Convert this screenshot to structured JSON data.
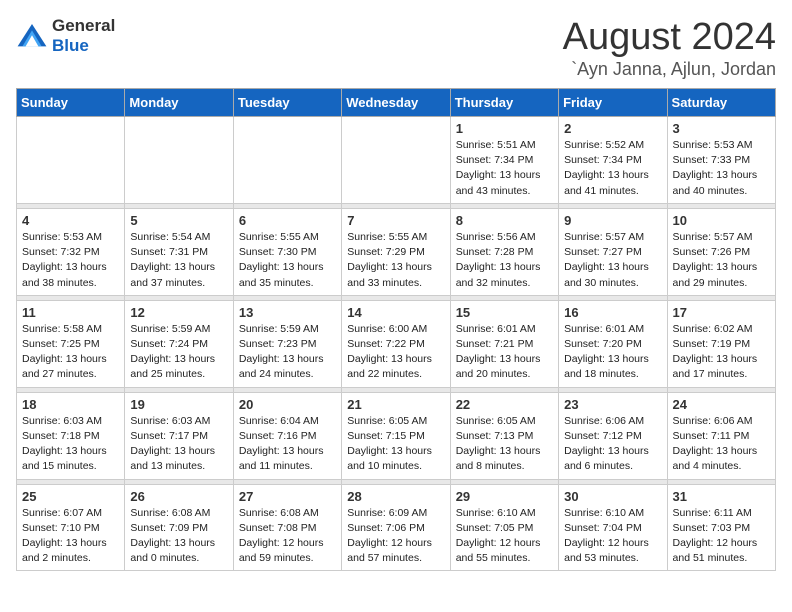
{
  "header": {
    "logo": {
      "general": "General",
      "blue": "Blue"
    },
    "title": "August 2024",
    "location": "`Ayn Janna, Ajlun, Jordan"
  },
  "days_of_week": [
    "Sunday",
    "Monday",
    "Tuesday",
    "Wednesday",
    "Thursday",
    "Friday",
    "Saturday"
  ],
  "weeks": [
    [
      {
        "day": "",
        "info": ""
      },
      {
        "day": "",
        "info": ""
      },
      {
        "day": "",
        "info": ""
      },
      {
        "day": "",
        "info": ""
      },
      {
        "day": "1",
        "info": "Sunrise: 5:51 AM\nSunset: 7:34 PM\nDaylight: 13 hours\nand 43 minutes."
      },
      {
        "day": "2",
        "info": "Sunrise: 5:52 AM\nSunset: 7:34 PM\nDaylight: 13 hours\nand 41 minutes."
      },
      {
        "day": "3",
        "info": "Sunrise: 5:53 AM\nSunset: 7:33 PM\nDaylight: 13 hours\nand 40 minutes."
      }
    ],
    [
      {
        "day": "4",
        "info": "Sunrise: 5:53 AM\nSunset: 7:32 PM\nDaylight: 13 hours\nand 38 minutes."
      },
      {
        "day": "5",
        "info": "Sunrise: 5:54 AM\nSunset: 7:31 PM\nDaylight: 13 hours\nand 37 minutes."
      },
      {
        "day": "6",
        "info": "Sunrise: 5:55 AM\nSunset: 7:30 PM\nDaylight: 13 hours\nand 35 minutes."
      },
      {
        "day": "7",
        "info": "Sunrise: 5:55 AM\nSunset: 7:29 PM\nDaylight: 13 hours\nand 33 minutes."
      },
      {
        "day": "8",
        "info": "Sunrise: 5:56 AM\nSunset: 7:28 PM\nDaylight: 13 hours\nand 32 minutes."
      },
      {
        "day": "9",
        "info": "Sunrise: 5:57 AM\nSunset: 7:27 PM\nDaylight: 13 hours\nand 30 minutes."
      },
      {
        "day": "10",
        "info": "Sunrise: 5:57 AM\nSunset: 7:26 PM\nDaylight: 13 hours\nand 29 minutes."
      }
    ],
    [
      {
        "day": "11",
        "info": "Sunrise: 5:58 AM\nSunset: 7:25 PM\nDaylight: 13 hours\nand 27 minutes."
      },
      {
        "day": "12",
        "info": "Sunrise: 5:59 AM\nSunset: 7:24 PM\nDaylight: 13 hours\nand 25 minutes."
      },
      {
        "day": "13",
        "info": "Sunrise: 5:59 AM\nSunset: 7:23 PM\nDaylight: 13 hours\nand 24 minutes."
      },
      {
        "day": "14",
        "info": "Sunrise: 6:00 AM\nSunset: 7:22 PM\nDaylight: 13 hours\nand 22 minutes."
      },
      {
        "day": "15",
        "info": "Sunrise: 6:01 AM\nSunset: 7:21 PM\nDaylight: 13 hours\nand 20 minutes."
      },
      {
        "day": "16",
        "info": "Sunrise: 6:01 AM\nSunset: 7:20 PM\nDaylight: 13 hours\nand 18 minutes."
      },
      {
        "day": "17",
        "info": "Sunrise: 6:02 AM\nSunset: 7:19 PM\nDaylight: 13 hours\nand 17 minutes."
      }
    ],
    [
      {
        "day": "18",
        "info": "Sunrise: 6:03 AM\nSunset: 7:18 PM\nDaylight: 13 hours\nand 15 minutes."
      },
      {
        "day": "19",
        "info": "Sunrise: 6:03 AM\nSunset: 7:17 PM\nDaylight: 13 hours\nand 13 minutes."
      },
      {
        "day": "20",
        "info": "Sunrise: 6:04 AM\nSunset: 7:16 PM\nDaylight: 13 hours\nand 11 minutes."
      },
      {
        "day": "21",
        "info": "Sunrise: 6:05 AM\nSunset: 7:15 PM\nDaylight: 13 hours\nand 10 minutes."
      },
      {
        "day": "22",
        "info": "Sunrise: 6:05 AM\nSunset: 7:13 PM\nDaylight: 13 hours\nand 8 minutes."
      },
      {
        "day": "23",
        "info": "Sunrise: 6:06 AM\nSunset: 7:12 PM\nDaylight: 13 hours\nand 6 minutes."
      },
      {
        "day": "24",
        "info": "Sunrise: 6:06 AM\nSunset: 7:11 PM\nDaylight: 13 hours\nand 4 minutes."
      }
    ],
    [
      {
        "day": "25",
        "info": "Sunrise: 6:07 AM\nSunset: 7:10 PM\nDaylight: 13 hours\nand 2 minutes."
      },
      {
        "day": "26",
        "info": "Sunrise: 6:08 AM\nSunset: 7:09 PM\nDaylight: 13 hours\nand 0 minutes."
      },
      {
        "day": "27",
        "info": "Sunrise: 6:08 AM\nSunset: 7:08 PM\nDaylight: 12 hours\nand 59 minutes."
      },
      {
        "day": "28",
        "info": "Sunrise: 6:09 AM\nSunset: 7:06 PM\nDaylight: 12 hours\nand 57 minutes."
      },
      {
        "day": "29",
        "info": "Sunrise: 6:10 AM\nSunset: 7:05 PM\nDaylight: 12 hours\nand 55 minutes."
      },
      {
        "day": "30",
        "info": "Sunrise: 6:10 AM\nSunset: 7:04 PM\nDaylight: 12 hours\nand 53 minutes."
      },
      {
        "day": "31",
        "info": "Sunrise: 6:11 AM\nSunset: 7:03 PM\nDaylight: 12 hours\nand 51 minutes."
      }
    ]
  ]
}
